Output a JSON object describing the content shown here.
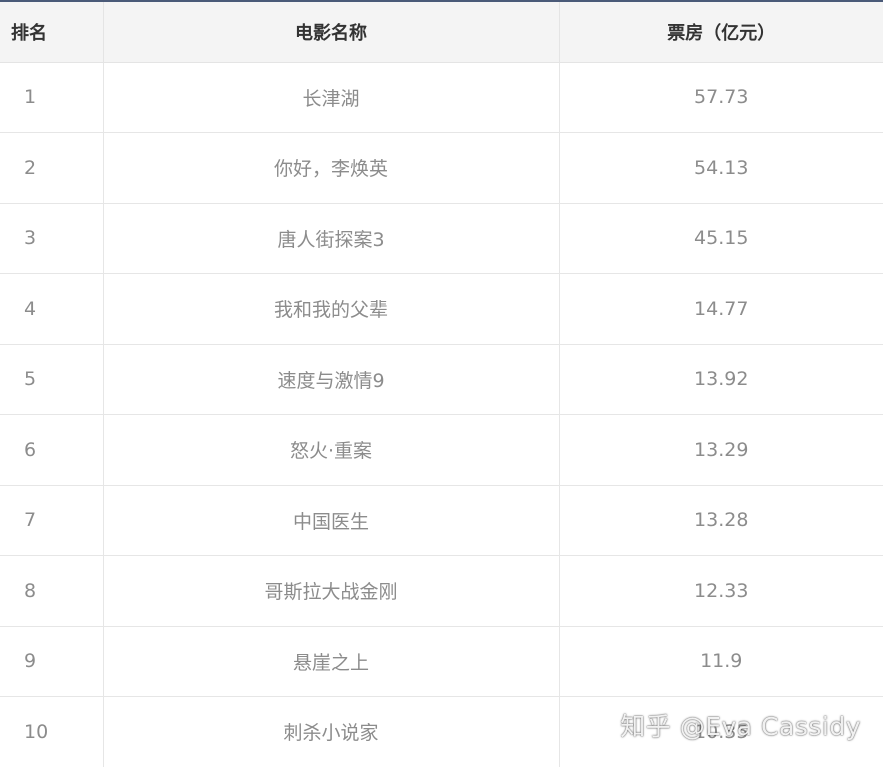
{
  "table": {
    "headers": {
      "rank": "排名",
      "name": "电影名称",
      "box": "票房（亿元）"
    },
    "rows": [
      {
        "rank": "1",
        "name": "长津湖",
        "box": "57.73"
      },
      {
        "rank": "2",
        "name": "你好，李焕英",
        "box": "54.13"
      },
      {
        "rank": "3",
        "name": "唐人街探案3",
        "box": "45.15"
      },
      {
        "rank": "4",
        "name": "我和我的父辈",
        "box": "14.77"
      },
      {
        "rank": "5",
        "name": "速度与激情9",
        "box": "13.92"
      },
      {
        "rank": "6",
        "name": "怒火·重案",
        "box": "13.29"
      },
      {
        "rank": "7",
        "name": "中国医生",
        "box": "13.28"
      },
      {
        "rank": "8",
        "name": "哥斯拉大战金刚",
        "box": "12.33"
      },
      {
        "rank": "9",
        "name": "悬崖之上",
        "box": "11.9"
      },
      {
        "rank": "10",
        "name": "刺杀小说家",
        "box": "10.35"
      }
    ]
  },
  "watermark": "知乎 @Eva Cassidy"
}
